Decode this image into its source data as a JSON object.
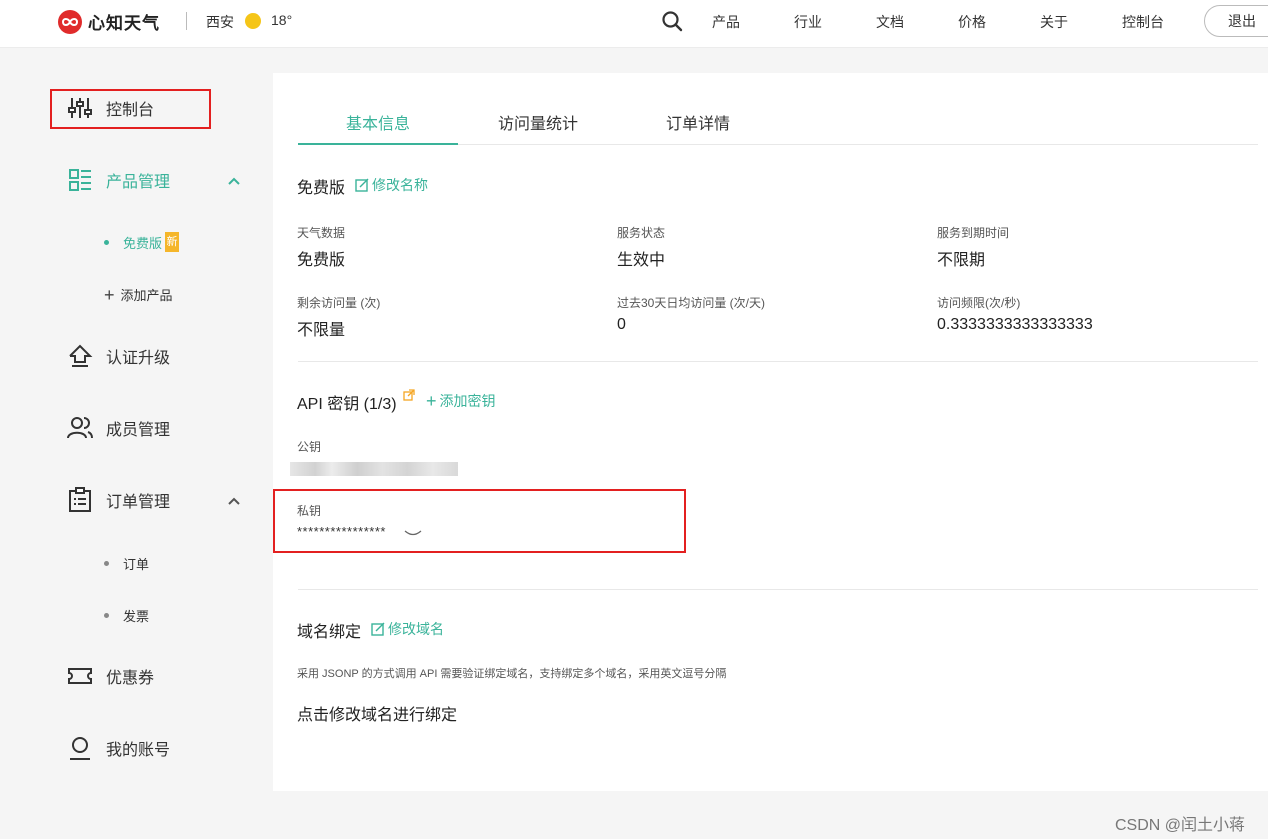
{
  "header": {
    "logo_text": "心知天气",
    "city": "西安",
    "temperature": "18°",
    "nav": [
      "产品",
      "行业",
      "文档",
      "价格",
      "关于",
      "控制台"
    ],
    "logout_label": "退出"
  },
  "sidebar": {
    "console": "控制台",
    "product_mgmt": "产品管理",
    "free_plan": "免费版",
    "new_badge": "新",
    "add_product": "添加产品",
    "cert_upgrade": "认证升级",
    "member_mgmt": "成员管理",
    "order_mgmt": "订单管理",
    "orders": "订单",
    "invoice": "发票",
    "coupons": "优惠券",
    "my_account": "我的账号"
  },
  "tabs": [
    "基本信息",
    "访问量统计",
    "订单详情"
  ],
  "plan": {
    "name": "免费版",
    "rename_label": "修改名称",
    "fields": [
      {
        "label": "天气数据",
        "value": "免费版"
      },
      {
        "label": "服务状态",
        "value": "生效中"
      },
      {
        "label": "服务到期时间",
        "value": "不限期"
      },
      {
        "label": "剩余访问量 (次)",
        "value": "不限量"
      },
      {
        "label": "过去30天日均访问量 (次/天)",
        "value": "0"
      },
      {
        "label": "访问频限(次/秒)",
        "value": "0.3333333333333333"
      }
    ]
  },
  "api": {
    "title": "API 密钥 (1/3)",
    "add_key_label": "添加密钥",
    "public_key_label": "公钥",
    "private_key_label": "私钥",
    "private_key_value": "****************"
  },
  "domain": {
    "title": "域名绑定",
    "edit_label": "修改域名",
    "description": "采用 JSONP 的方式调用 API 需要验证绑定域名，支持绑定多个域名，采用英文逗号分隔",
    "hint": "点击修改域名进行绑定"
  },
  "watermark": "CSDN @闰土小蒋",
  "colors": {
    "accent": "#3ab39a",
    "highlight_box": "#e32020",
    "logo_red": "#e02b2b",
    "badge": "#f5b62a"
  }
}
